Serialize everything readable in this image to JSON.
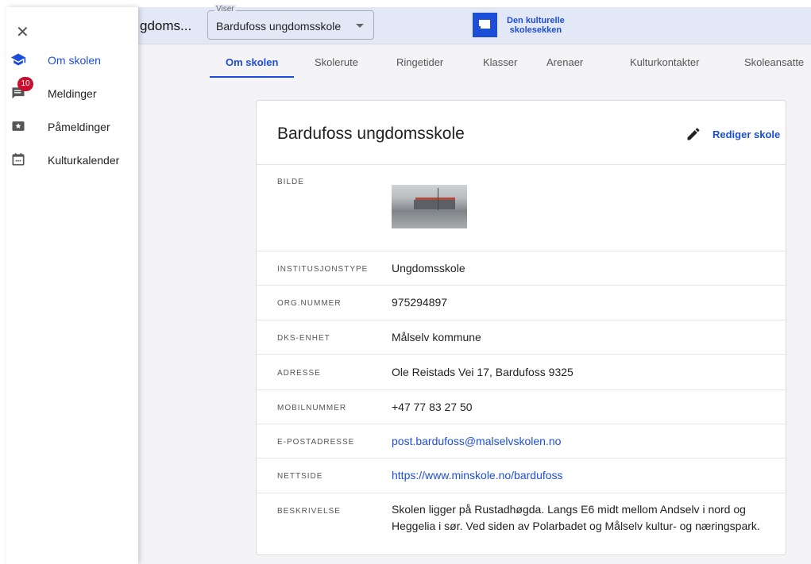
{
  "header": {
    "school_truncated": "gdoms...",
    "viser_label": "Viser",
    "viser_value": "Bardufoss ungdomsskole",
    "logo_line1": "Den kulturelle",
    "logo_line2": "skolesekken"
  },
  "tabs": [
    {
      "label": "Om skolen",
      "active": true
    },
    {
      "label": "Skolerute"
    },
    {
      "label": "Ringetider"
    },
    {
      "label": "Klasser"
    },
    {
      "label": "Arenaer"
    },
    {
      "label": "Kulturkontakter"
    },
    {
      "label": "Skoleansatte"
    }
  ],
  "drawer": {
    "items": [
      {
        "label": "Om skolen",
        "icon": "school-icon",
        "active": true
      },
      {
        "label": "Meldinger",
        "icon": "message-icon",
        "badge": "10"
      },
      {
        "label": "Påmeldinger",
        "icon": "star-card-icon"
      },
      {
        "label": "Kulturkalender",
        "icon": "calendar-icon"
      }
    ]
  },
  "card": {
    "title": "Bardufoss ungdomsskole",
    "edit_label": "Rediger skole",
    "rows": [
      {
        "label": "BILDE",
        "value": ""
      },
      {
        "label": "INSTITUSJONSTYPE",
        "value": "Ungdomsskole"
      },
      {
        "label": "ORG.NUMMER",
        "value": "975294897"
      },
      {
        "label": "DKS-ENHET",
        "value": "Målselv kommune"
      },
      {
        "label": "ADRESSE",
        "value": "Ole Reistads Vei 17, Bardufoss 9325"
      },
      {
        "label": "MOBILNUMMER",
        "value": "+47 77 83 27 50"
      },
      {
        "label": "E-POSTADRESSE",
        "value": "post.bardufoss@malselvskolen.no"
      },
      {
        "label": "NETTSIDE",
        "value": "https://www.minskole.no/bardufoss"
      },
      {
        "label": "BESKRIVELSE",
        "value_line1": "Skolen ligger på Rustadhøgda. Langs E6 midt mellom Andselv i nord og",
        "value_line2": "Heggelia i sør. Ved siden av Polarbadet og Målselv kultur- og næringspark."
      }
    ]
  },
  "colors": {
    "accent": "#1d4ed8",
    "topbar": "#e3e8f7",
    "badge": "#c8102e"
  }
}
